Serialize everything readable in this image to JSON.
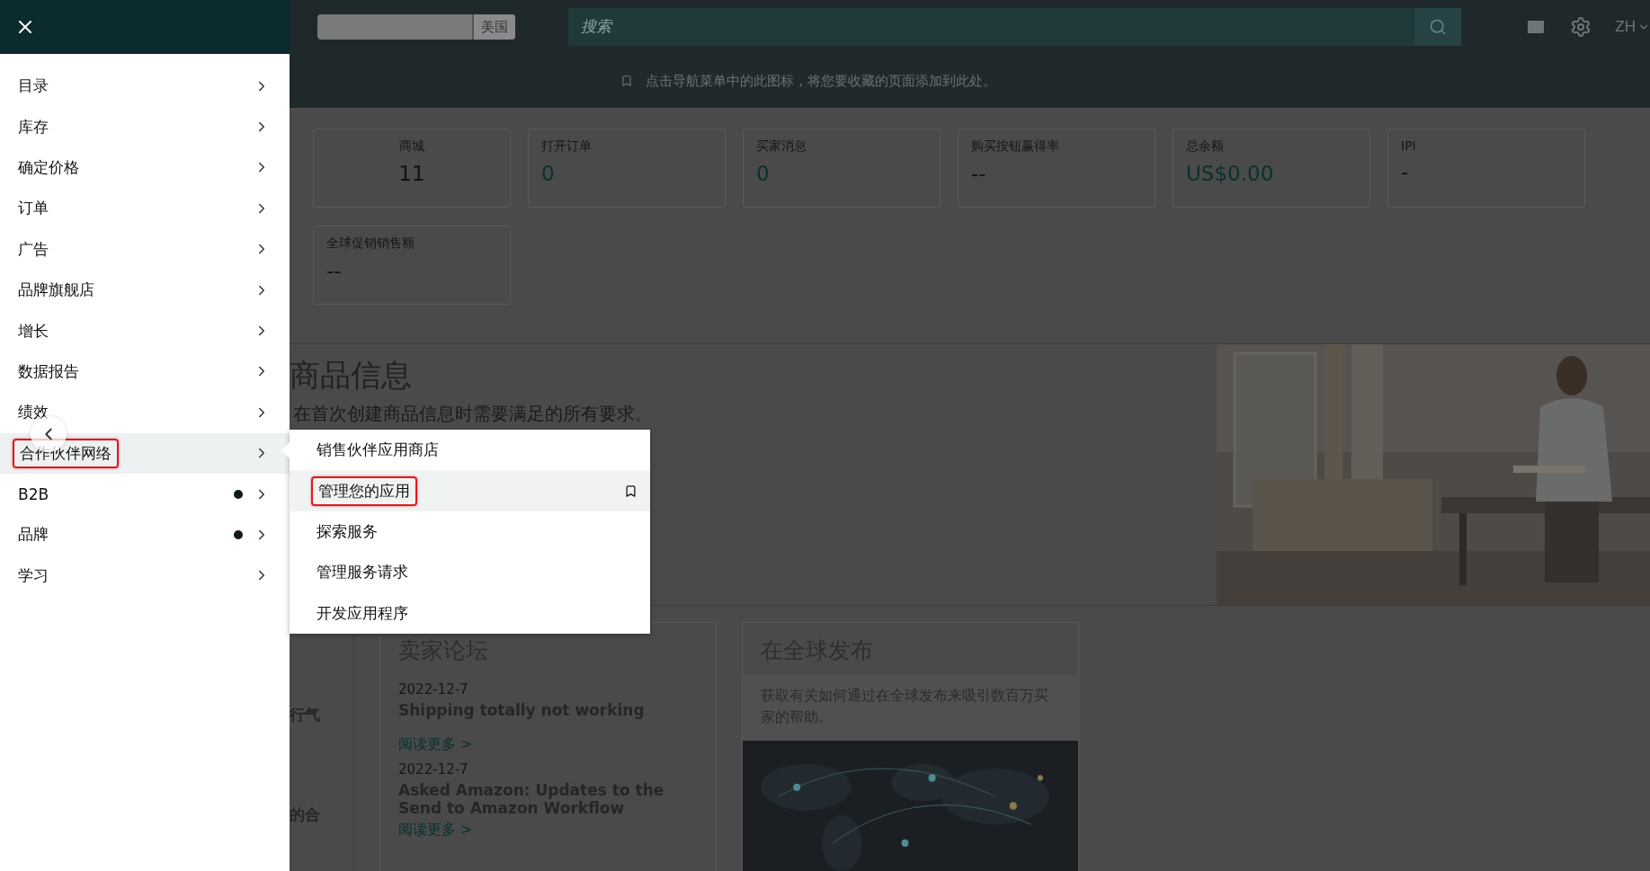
{
  "drawer": {
    "items": [
      {
        "label": "目录",
        "selected": false,
        "dot": false,
        "annotated": false
      },
      {
        "label": "库存",
        "selected": false,
        "dot": false,
        "annotated": false
      },
      {
        "label": "确定价格",
        "selected": false,
        "dot": false,
        "annotated": false
      },
      {
        "label": "订单",
        "selected": false,
        "dot": false,
        "annotated": false
      },
      {
        "label": "广告",
        "selected": false,
        "dot": false,
        "annotated": false
      },
      {
        "label": "品牌旗舰店",
        "selected": false,
        "dot": false,
        "annotated": false
      },
      {
        "label": "增长",
        "selected": false,
        "dot": false,
        "annotated": false
      },
      {
        "label": "数据报告",
        "selected": false,
        "dot": false,
        "annotated": false
      },
      {
        "label": "绩效",
        "selected": false,
        "dot": false,
        "annotated": false
      },
      {
        "label": "合作伙伴网络",
        "selected": true,
        "dot": false,
        "annotated": true
      },
      {
        "label": "B2B",
        "selected": false,
        "dot": true,
        "annotated": false
      },
      {
        "label": "品牌",
        "selected": false,
        "dot": true,
        "annotated": false
      },
      {
        "label": "学习",
        "selected": false,
        "dot": false,
        "annotated": false
      }
    ]
  },
  "submenu": {
    "items": [
      {
        "label": "销售伙伴应用商店",
        "selected": false,
        "annotated": false,
        "bookmark": false
      },
      {
        "label": "管理您的应用",
        "selected": true,
        "annotated": true,
        "bookmark": true
      },
      {
        "label": "探索服务",
        "selected": false,
        "annotated": false,
        "bookmark": false
      },
      {
        "label": "管理服务请求",
        "selected": false,
        "annotated": false,
        "bookmark": false
      },
      {
        "label": "开发应用程序",
        "selected": false,
        "annotated": false,
        "bookmark": false
      }
    ]
  },
  "topbar": {
    "marketplace": "美国",
    "search": {
      "placeholder": "搜索"
    },
    "language": "ZH"
  },
  "banner": "点击导航菜单中的此图标，将您要收藏的页面添加到此处。",
  "metrics": [
    {
      "label": "商城",
      "value": "11",
      "centered": true,
      "accent": false
    },
    {
      "label": "打开订单",
      "value": "0",
      "centered": false,
      "accent": true
    },
    {
      "label": "买家消息",
      "value": "0",
      "centered": false,
      "accent": true
    },
    {
      "label": "购买按钮赢得率",
      "value": "--",
      "centered": false,
      "accent": false
    },
    {
      "label": "总余额",
      "value": "US$0.00",
      "centered": false,
      "accent": true
    },
    {
      "label": "IPI",
      "value": "-",
      "centered": false,
      "accent": false
    },
    {
      "label": "全球促销销售额",
      "value": "--",
      "centered": false,
      "accent": false
    }
  ],
  "listing": {
    "title": "商品信息",
    "subtitle": "在首次创建商品信息时需要满足的所有要求。"
  },
  "column_1": [
    "行气",
    "的合"
  ],
  "forum": {
    "title": "卖家论坛",
    "posts": [
      {
        "date": "2022-12-7",
        "title": "Shipping totally not working",
        "link": "阅读更多 >"
      },
      {
        "date": "2022-12-7",
        "title": "Asked Amazon: Updates to the Send to Amazon Workflow",
        "link": "阅读更多 >"
      }
    ]
  },
  "global": {
    "title": "在全球发布",
    "text": "获取有关如何通过在全球发布来吸引数百万买家的帮助。"
  }
}
